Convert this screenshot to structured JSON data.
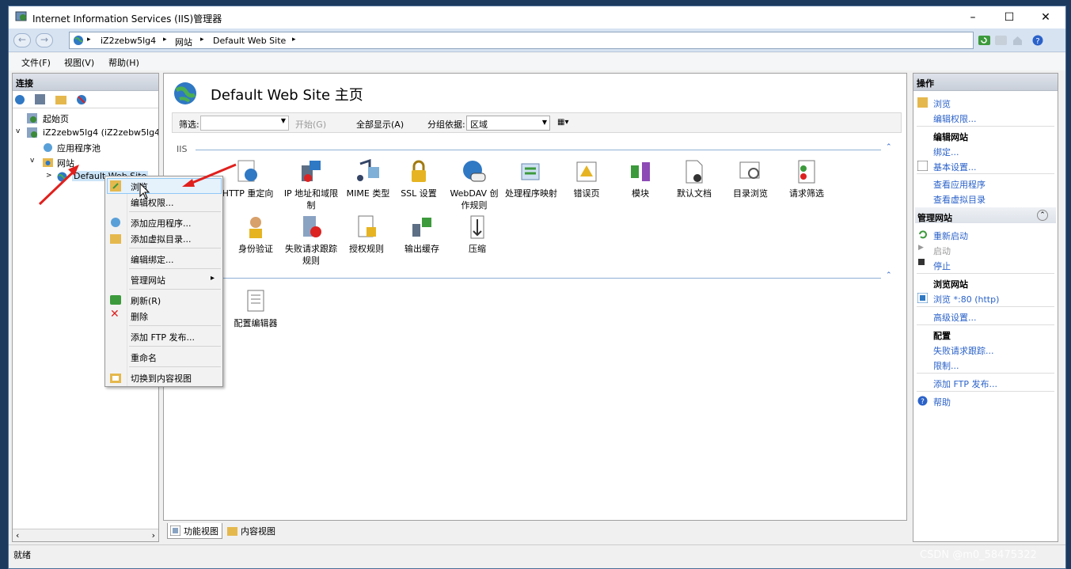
{
  "window": {
    "title": "Internet Information Services (IIS)管理器",
    "minimize": "–",
    "maximize": "☐",
    "close": "✕"
  },
  "address": {
    "back": "←",
    "forward": "→",
    "crumbs": [
      "iZ2zebw5lg4",
      "网站",
      "Default Web Site"
    ],
    "sep": "▸"
  },
  "menu": {
    "file": "文件(F)",
    "view": "视图(V)",
    "help": "帮助(H)"
  },
  "connections": {
    "title": "连接",
    "tree": {
      "start": "起始页",
      "server": "iZ2zebw5lg4 (iZ2zebw5lg4\\",
      "apppools": "应用程序池",
      "sites": "网站",
      "site": "Default Web Site"
    }
  },
  "center": {
    "title": "Default Web Site 主页",
    "filter": {
      "label": "筛选:",
      "start": "开始(G)",
      "showall": "全部显示(A)",
      "groupby": "分组依据:",
      "groupval": "区域"
    },
    "section_iis": "IIS",
    "tiles_row1": [
      {
        "label": "HTTP 重定向",
        "icon": "redirect-icon"
      },
      {
        "label": "IP 地址和域限制",
        "icon": "ip-restrict-icon"
      },
      {
        "label": "MIME 类型",
        "icon": "mime-icon"
      },
      {
        "label": "SSL 设置",
        "icon": "lock-icon"
      },
      {
        "label": "WebDAV 创作规则",
        "icon": "webdav-icon"
      },
      {
        "label": "处理程序映射",
        "icon": "handler-icon"
      },
      {
        "label": "错误页",
        "icon": "error-page-icon"
      },
      {
        "label": "模块",
        "icon": "modules-icon"
      },
      {
        "label": "默认文档",
        "icon": "default-doc-icon"
      },
      {
        "label": "目录浏览",
        "icon": "dir-browse-icon"
      },
      {
        "label": "请求筛选",
        "icon": "request-filter-icon"
      }
    ],
    "partial_label": "",
    "tiles_row2": [
      {
        "label": "身份验证",
        "icon": "auth-icon"
      },
      {
        "label": "失败请求跟踪规则",
        "icon": "failed-trace-icon"
      },
      {
        "label": "授权规则",
        "icon": "authz-icon"
      },
      {
        "label": "输出缓存",
        "icon": "output-cache-icon"
      },
      {
        "label": "压缩",
        "icon": "compress-icon"
      }
    ],
    "tile_mgmt": {
      "label": "配置编辑器",
      "icon": "config-editor-icon"
    },
    "tabs": {
      "features": "功能视图",
      "content": "内容视图"
    }
  },
  "context_menu": {
    "items": [
      "浏览",
      "编辑权限...",
      "添加应用程序...",
      "添加虚拟目录...",
      "编辑绑定...",
      "管理网站",
      "刷新(R)",
      "删除",
      "添加 FTP 发布...",
      "重命名",
      "切换到内容视图"
    ],
    "submenu_arrow": "▸"
  },
  "actions": {
    "title": "操作",
    "browse": "浏览",
    "edit_perm": "编辑权限...",
    "edit_site": "编辑网站",
    "bindings": "绑定...",
    "basic": "基本设置...",
    "view_apps": "查看应用程序",
    "view_vdirs": "查看虚拟目录",
    "manage_site": "管理网站",
    "restart": "重新启动",
    "start": "启动",
    "stop": "停止",
    "browse_site": "浏览网站",
    "browse_80": "浏览 *:80 (http)",
    "advanced": "高级设置...",
    "config": "配置",
    "failed_trace": "失败请求跟踪...",
    "limits": "限制...",
    "add_ftp": "添加 FTP 发布...",
    "help": "帮助"
  },
  "status": {
    "text": "就绪"
  },
  "watermark": "CSDN @m0_58475322",
  "colors": {
    "link": "#2b62c9",
    "accent": "#d7e3f1",
    "arrow": "#e0201d"
  }
}
